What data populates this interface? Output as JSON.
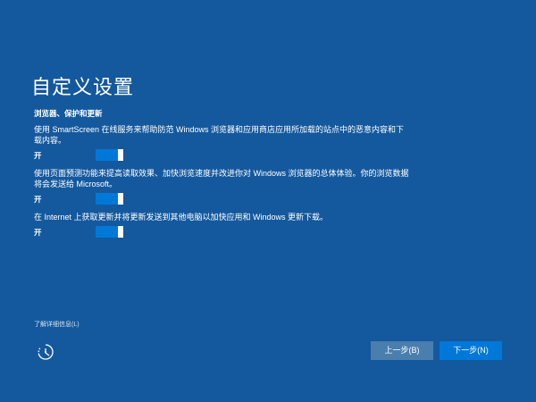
{
  "page": {
    "title": "自定义设置",
    "section_heading": "浏览器、保护和更新"
  },
  "settings": [
    {
      "description": "使用 SmartScreen 在线服务来帮助防范 Windows 浏览器和应用商店应用所加载的站点中的恶意内容和下载内容。",
      "state_label": "开",
      "on": true
    },
    {
      "description": "使用页面预测功能来提高读取效果、加快浏览速度并改进你对 Windows 浏览器的总体体验。你的浏览数据将会发送给 Microsoft。",
      "state_label": "开",
      "on": true
    },
    {
      "description": "在 Internet 上获取更新并将更新发送到其他电脑以加快应用和 Windows 更新下载。",
      "state_label": "开",
      "on": true
    }
  ],
  "footer": {
    "learn_more": "了解详细信息(L)",
    "back_button": "上一步(B)",
    "next_button": "下一步(N)",
    "accessibility_icon": "ease-of-access-icon"
  },
  "colors": {
    "background": "#14599e",
    "toggle_on": "#0078d7",
    "back_button": "#4a7eaf",
    "next_button": "#0078d7"
  }
}
